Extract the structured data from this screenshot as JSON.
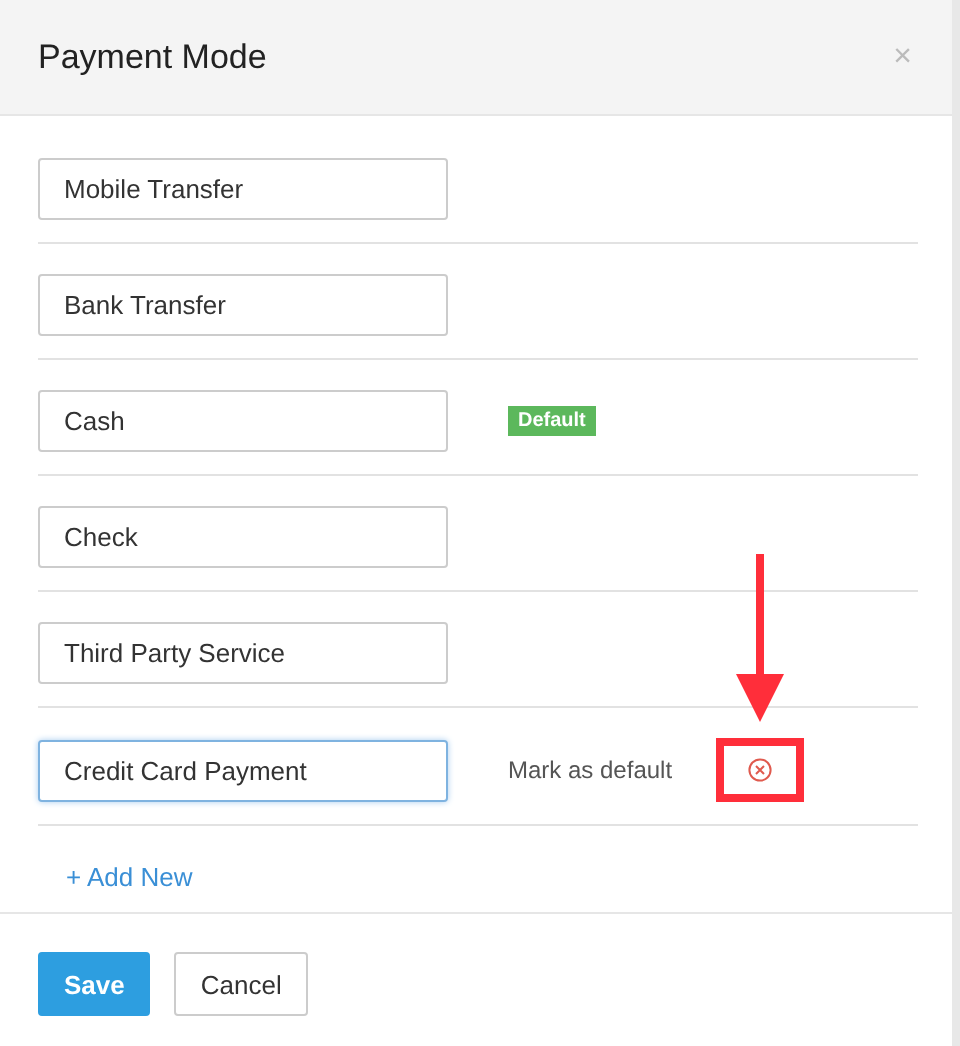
{
  "dialog": {
    "title": "Payment Mode",
    "close": "×"
  },
  "modes": [
    {
      "value": "Mobile Transfer",
      "focused": false
    },
    {
      "value": "Bank Transfer",
      "focused": false
    },
    {
      "value": "Cash",
      "focused": false,
      "badge": "Default"
    },
    {
      "value": "Check",
      "focused": false
    },
    {
      "value": "Third Party Service",
      "focused": false
    },
    {
      "value": "Credit Card Payment",
      "focused": true,
      "action": "Mark as default",
      "deletable": true,
      "highlighted": true
    }
  ],
  "add_link": "+ Add New",
  "buttons": [
    {
      "label": "Save",
      "kind": "primary"
    },
    {
      "label": "Cancel",
      "kind": "secondary"
    }
  ]
}
